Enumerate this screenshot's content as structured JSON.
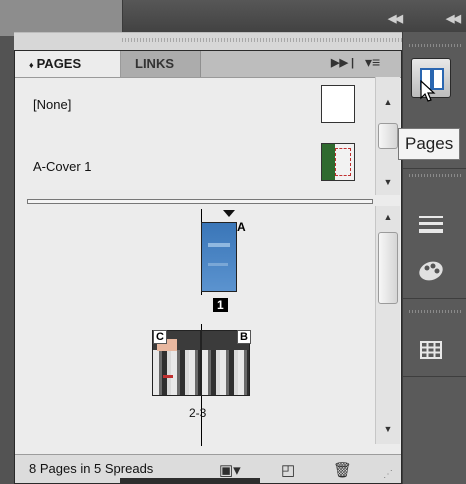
{
  "panel": {
    "tabs": [
      {
        "label": "PAGES",
        "active": true,
        "prefix": "♦"
      },
      {
        "label": "LINKS",
        "active": false
      }
    ],
    "menu_icons": [
      "forward-arrows-icon",
      "panel-menu-icon"
    ]
  },
  "masters": [
    {
      "label": "[None]",
      "thumb": "blank"
    },
    {
      "label": "A-Cover 1",
      "thumb": "cover"
    }
  ],
  "pages": {
    "current_page_label": "1",
    "current_page_master": "A",
    "spread_label": "2-3",
    "spread_masters": [
      "C",
      "B"
    ]
  },
  "footer": {
    "status": "8 Pages in 5 Spreads"
  },
  "dock": {
    "active_button": "pages",
    "tooltip": "Pages",
    "buttons": [
      "pages-icon",
      "stroke-icon",
      "swatches-icon",
      "table-icon"
    ]
  },
  "colors": {
    "panel_bg": "#ececec",
    "dock_bg": "#5a5a5a",
    "page1_fill": "#4a86c8"
  }
}
